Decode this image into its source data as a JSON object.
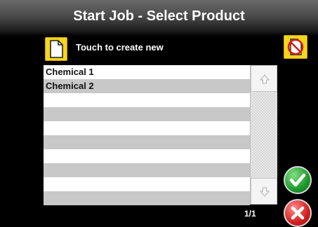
{
  "header": {
    "title": "Start Job - Select Product"
  },
  "toolbar": {
    "new_icon": "new-document-icon",
    "new_label": "Touch to create new",
    "no_product_icon": "no-product-icon"
  },
  "products": [
    {
      "name": "Chemical 1"
    },
    {
      "name": "Chemical 2"
    },
    {
      "name": ""
    },
    {
      "name": ""
    },
    {
      "name": ""
    },
    {
      "name": ""
    },
    {
      "name": ""
    },
    {
      "name": ""
    },
    {
      "name": ""
    },
    {
      "name": ""
    }
  ],
  "scrollbar": {
    "up_icon": "arrow-up-icon",
    "down_icon": "arrow-down-icon"
  },
  "pagination": {
    "text": "1/1"
  },
  "actions": {
    "confirm_icon": "checkmark-icon",
    "cancel_icon": "x-icon"
  },
  "colors": {
    "button_yellow": "#f5d51e",
    "confirm_green": "#1e9a2e",
    "cancel_red": "#d42020",
    "row_alt": "#c8c8c8"
  }
}
